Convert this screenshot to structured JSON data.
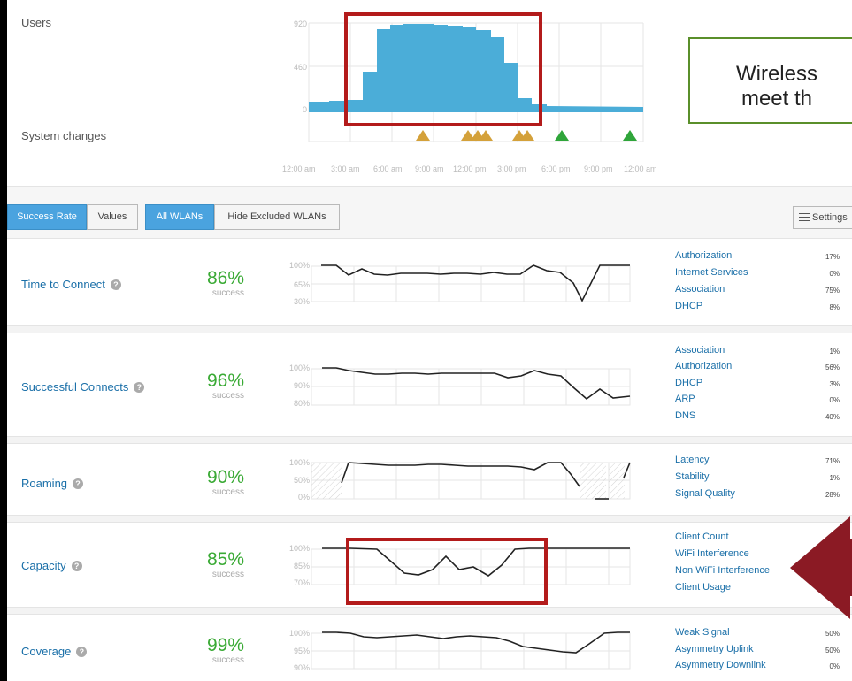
{
  "users_panel": {
    "label": "Users",
    "system_changes_label": "System changes",
    "y_ticks": [
      "920",
      "460",
      "0"
    ],
    "x_ticks": [
      "12:00 am",
      "3:00 am",
      "6:00 am",
      "9:00 am",
      "12:00 pm",
      "3:00 pm",
      "6:00 pm",
      "9:00 pm",
      "12:00 am"
    ]
  },
  "annotation": {
    "line1": "Wireless",
    "line2": "meet th"
  },
  "filters": {
    "success_rate": "Success Rate",
    "values": "Values",
    "all_wlans": "All WLANs",
    "hide_excluded": "Hide Excluded WLANs",
    "settings": "Settings"
  },
  "metrics": [
    {
      "name": "Time to Connect",
      "percent": "86%",
      "success": "success",
      "y_ticks": [
        "100%",
        "65%",
        "30%"
      ],
      "classifiers": [
        {
          "label": "Authorization",
          "value": "17%"
        },
        {
          "label": "Internet Services",
          "value": "0%"
        },
        {
          "label": "Association",
          "value": "75%"
        },
        {
          "label": "DHCP",
          "value": "8%"
        }
      ]
    },
    {
      "name": "Successful Connects",
      "percent": "96%",
      "success": "success",
      "y_ticks": [
        "100%",
        "90%",
        "80%"
      ],
      "classifiers": [
        {
          "label": "Association",
          "value": "1%"
        },
        {
          "label": "Authorization",
          "value": "56%"
        },
        {
          "label": "DHCP",
          "value": "3%"
        },
        {
          "label": "ARP",
          "value": "0%"
        },
        {
          "label": "DNS",
          "value": "40%"
        }
      ]
    },
    {
      "name": "Roaming",
      "percent": "90%",
      "success": "success",
      "y_ticks": [
        "100%",
        "50%",
        "0%"
      ],
      "classifiers": [
        {
          "label": "Latency",
          "value": "71%"
        },
        {
          "label": "Stability",
          "value": "1%"
        },
        {
          "label": "Signal Quality",
          "value": "28%"
        }
      ]
    },
    {
      "name": "Capacity",
      "percent": "85%",
      "success": "success",
      "y_ticks": [
        "100%",
        "85%",
        "70%"
      ],
      "classifiers": [
        {
          "label": "Client Count",
          "value": ""
        },
        {
          "label": "WiFi Interference",
          "value": ""
        },
        {
          "label": "Non WiFi Interference",
          "value": ""
        },
        {
          "label": "Client Usage",
          "value": ""
        }
      ]
    },
    {
      "name": "Coverage",
      "percent": "99%",
      "success": "success",
      "y_ticks": [
        "100%",
        "95%",
        "90%"
      ],
      "classifiers": [
        {
          "label": "Weak Signal",
          "value": "50%"
        },
        {
          "label": "Asymmetry Uplink",
          "value": "50%"
        },
        {
          "label": "Asymmetry Downlink",
          "value": "0%"
        }
      ]
    }
  ],
  "colors": {
    "users_area": "#4badd8",
    "change_amber": "#d4a13a",
    "change_green": "#2fa53a",
    "success_green": "#3aaa35",
    "link_blue": "#1a6fa8",
    "highlight_red": "#b31b1b",
    "arrow_red": "#8b1a24",
    "annotation_border": "#5a8f2a"
  }
}
